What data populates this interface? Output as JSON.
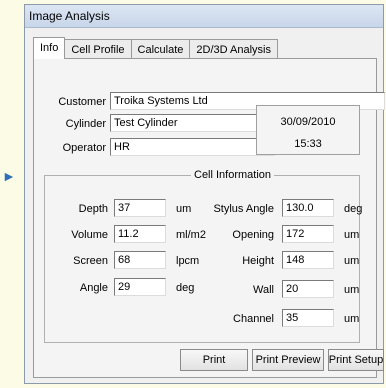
{
  "window": {
    "title": "Image Analysis"
  },
  "tabs": [
    {
      "label": "Info"
    },
    {
      "label": "Cell Profile"
    },
    {
      "label": "Calculate"
    },
    {
      "label": "2D/3D Analysis"
    }
  ],
  "customer": {
    "label": "Customer",
    "value": "Troika Systems Ltd"
  },
  "cylinder": {
    "label": "Cylinder",
    "value": "Test Cylinder"
  },
  "operator": {
    "label": "Operator",
    "value": "HR"
  },
  "datetime": {
    "date": "30/09/2010",
    "time": "15:33"
  },
  "cell_info": {
    "title": "Cell Information",
    "depth": {
      "label": "Depth",
      "value": "37",
      "unit": "um"
    },
    "volume": {
      "label": "Volume",
      "value": "11.2",
      "unit": "ml/m2"
    },
    "screen": {
      "label": "Screen",
      "value": "68",
      "unit": "lpcm"
    },
    "angle": {
      "label": "Angle",
      "value": "29",
      "unit": "deg"
    },
    "stylus_angle": {
      "label": "Stylus Angle",
      "value": "130.0",
      "unit": "deg"
    },
    "opening": {
      "label": "Opening",
      "value": "172",
      "unit": "um"
    },
    "height": {
      "label": "Height",
      "value": "148",
      "unit": "um"
    },
    "wall": {
      "label": "Wall",
      "value": "20",
      "unit": "um"
    },
    "channel": {
      "label": "Channel",
      "value": "35",
      "unit": "um"
    }
  },
  "buttons": {
    "print": "Print",
    "print_preview": "Print Preview",
    "print_setup": "Print Setup"
  }
}
